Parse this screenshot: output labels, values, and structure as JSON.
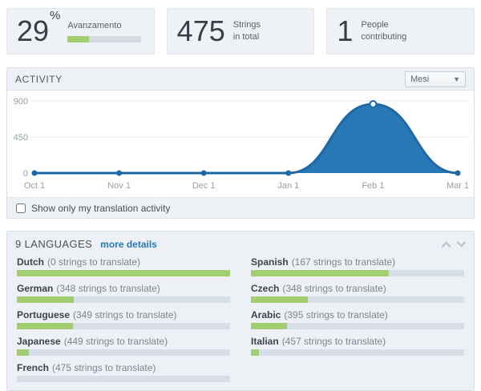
{
  "stats": {
    "progress": {
      "value": "29",
      "unit": "%",
      "label": "Avanzamento",
      "percent": 29
    },
    "strings": {
      "value": "475",
      "line1": "Strings",
      "line2": "in total"
    },
    "people": {
      "value": "1",
      "line1": "People",
      "line2": "contributing"
    }
  },
  "activity": {
    "title": "ACTIVITY",
    "period_select": {
      "value": "Mesi"
    },
    "checkbox_label": "Show only my translation activity",
    "checkbox_checked": false
  },
  "chart_data": {
    "type": "area",
    "title": "ACTIVITY",
    "series_name": "translation activity",
    "x": [
      "Oct 1",
      "Nov 1",
      "Dec 1",
      "Jan 1",
      "Feb 1",
      "Mar 1"
    ],
    "values": [
      0,
      0,
      0,
      0,
      860,
      0
    ],
    "y_ticks": [
      0,
      450,
      900
    ],
    "ylim": [
      0,
      900
    ],
    "grid": true,
    "legend": "none",
    "fill_color": "#2878b5",
    "line_color": "#1e68a6"
  },
  "languages": {
    "title": "9 LANGUAGES",
    "link_label": "more details",
    "total_strings": 475,
    "count_suffix": "strings to translate",
    "items": [
      {
        "name": "Dutch",
        "to_translate": 0
      },
      {
        "name": "Spanish",
        "to_translate": 167
      },
      {
        "name": "German",
        "to_translate": 348
      },
      {
        "name": "Czech",
        "to_translate": 348
      },
      {
        "name": "Portuguese",
        "to_translate": 349
      },
      {
        "name": "Arabic",
        "to_translate": 395
      },
      {
        "name": "Japanese",
        "to_translate": 449
      },
      {
        "name": "Italian",
        "to_translate": 457
      },
      {
        "name": "French",
        "to_translate": 475
      }
    ]
  },
  "colors": {
    "accent_blue": "#2878b5",
    "progress_green": "#a3cd71",
    "track_gray": "#d6dfe7",
    "link_blue": "#2879b8"
  }
}
